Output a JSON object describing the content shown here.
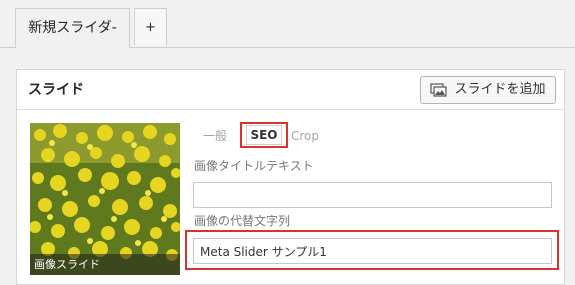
{
  "tabs": {
    "slider_tab_label": "新規スライダ-",
    "add_tab_label": "+"
  },
  "panel": {
    "title": "スライド",
    "add_slide_button": "スライドを追加"
  },
  "slide": {
    "thumbnail_caption": "画像スライド",
    "subtabs": {
      "general": "一般",
      "seo": "SEO",
      "crop": "Crop"
    },
    "image_title_label": "画像タイトルテキスト",
    "image_title_value": "",
    "alt_text_label": "画像の代替文字列",
    "alt_text_value": "Meta Slider サンプル1"
  },
  "colors": {
    "highlight": "#d9322a",
    "background": "#f1f1f1"
  },
  "icons": {
    "add_slide": "image-add-icon"
  }
}
